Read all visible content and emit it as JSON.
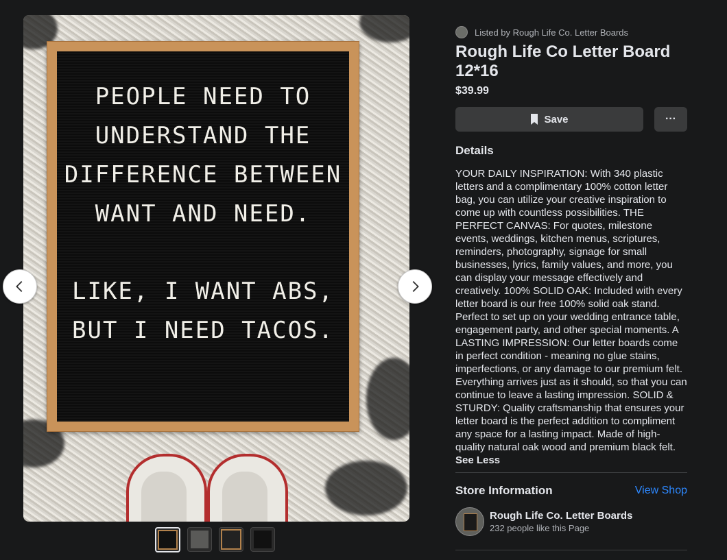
{
  "product": {
    "listed_by": "Listed by Rough Life Co. Letter Boards",
    "title": "Rough Life Co Letter Board 12*16",
    "price": "$39.99",
    "save_label": "Save",
    "more_label": "···"
  },
  "details": {
    "heading": "Details",
    "description": "YOUR DAILY INSPIRATION: With 340 plastic letters and a complimentary 100% cotton letter bag, you can utilize your creative inspiration to come up with countless possibilities. THE PERFECT CANVAS: For quotes, milestone events, weddings, kitchen menus, scriptures, reminders, photography, signage for small businesses, lyrics, family values, and more, you can display your message effectively and creatively. 100% SOLID OAK: Included with every letter board is our free 100% solid oak stand. Perfect to set up on your wedding entrance table, engagement party, and other special moments. A LASTING IMPRESSION: Our letter boards come in perfect condition - meaning no glue stains, imperfections, or any damage to our premium felt. Everything arrives just as it should, so that you can continue to leave a lasting impression. SOLID & STURDY: Quality craftsmanship that ensures your letter board is the perfect addition to compliment any space for a lasting impact. Made of high-quality natural oak wood and premium black felt.",
    "see_less": "See Less"
  },
  "store": {
    "heading": "Store Information",
    "view_shop": "View Shop",
    "name": "Rough Life Co. Letter Boards",
    "likes": "232 people like this Page"
  },
  "photo": {
    "board_lines": [
      "PEOPLE NEED TO",
      "UNDERSTAND THE",
      "DIFFERENCE BETWEEN",
      "WANT AND NEED."
    ],
    "board_lines_2": [
      "LIKE, I WANT ABS,",
      "BUT I NEED TACOS."
    ]
  },
  "thumbnails": {
    "count": 4,
    "active_index": 0
  },
  "colors": {
    "background": "#18191a",
    "button": "#3a3b3c",
    "link": "#2d88ff"
  }
}
